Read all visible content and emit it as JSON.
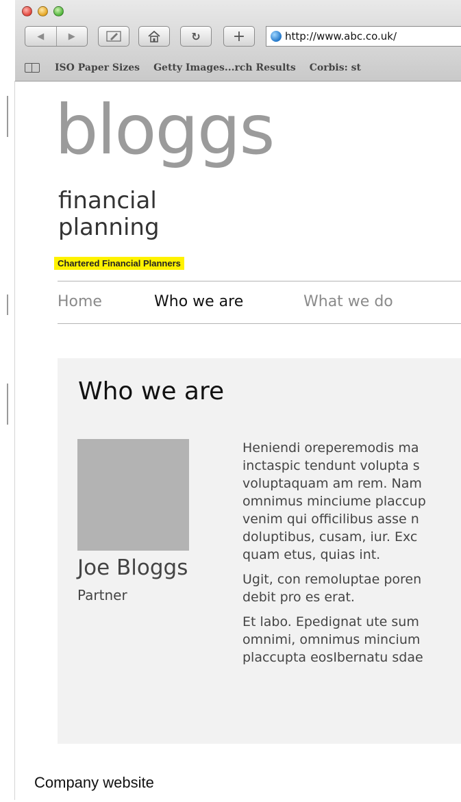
{
  "browser": {
    "url": "http://www.abc.co.uk/",
    "bookmarks": [
      "ISO Paper Sizes",
      "Getty Images...rch Results",
      "Corbis: st"
    ]
  },
  "site": {
    "logo": "bloggs",
    "tagline_line1": "financial",
    "tagline_line2": "planning",
    "badge": "Chartered Financial Planners",
    "accent_color": "#fff200"
  },
  "nav": {
    "items": [
      "Home",
      "Who we are",
      "What we do"
    ],
    "active": "Who we are"
  },
  "main": {
    "heading": "Who we are",
    "person": {
      "name": "Joe Bloggs",
      "role": "Partner"
    },
    "paragraph1_lines": [
      "Heniendi oreperemodis ma",
      "inctaspic tendunt volupta s",
      "voluptaquam am rem. Nam",
      "omnimus minciume placcup",
      "venim qui officilibus asse n",
      "doluptibus, cusam, iur. Exc",
      "quam etus, quias int."
    ],
    "paragraph2_lines": [
      "Ugit, con remoluptae poren",
      "debit pro es erat."
    ],
    "paragraph3_lines": [
      "Et labo. Epedignat ute sum",
      "omnimi, omnimus mincium",
      "placcupta eosIbernatu sdae"
    ]
  },
  "caption": "Company website"
}
